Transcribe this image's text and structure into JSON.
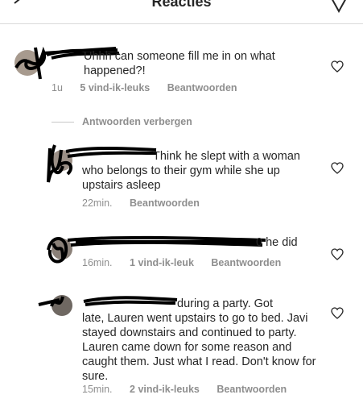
{
  "header": {
    "title": "Reacties"
  },
  "icons": {
    "back": "chevron-left-icon",
    "send": "paper-plane-icon",
    "like": "heart-icon"
  },
  "comments": [
    {
      "text": "Uhhh can someone fill me in on what happened?!",
      "time": "1u",
      "likes": "5 vind-ik-leuks",
      "reply": "Beantwoorden"
    }
  ],
  "replies_toggle": "Antwoorden verbergen",
  "replies": [
    {
      "text": "Think he slept with a woman who belongs to their gym while she up upstairs asleep",
      "time": "22min.",
      "reply": "Beantwoorden"
    },
    {
      "text": "0 he did",
      "time": "16min.",
      "likes": "1 vind-ik-leuk",
      "reply": "Beantwoorden"
    },
    {
      "text_line1": "during a party. Got",
      "text_rest": "late, Lauren went upstairs to go to bed. Javi stayed downstairs and continued to party. Lauren came down for some reason and caught them. Just what I read. Don't know for sure.",
      "time": "15min.",
      "likes": "2 vind-ik-leuks",
      "reply": "Beantwoorden"
    }
  ]
}
